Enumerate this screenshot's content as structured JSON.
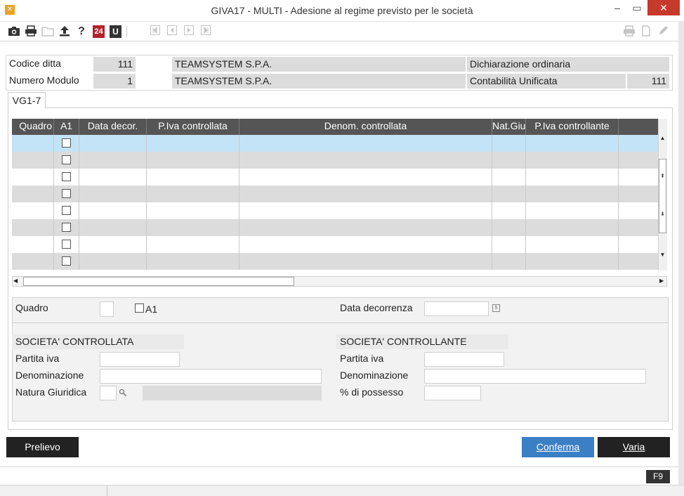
{
  "window": {
    "title": "GIVA17  - MULTI -  Adesione al regime previsto per le società",
    "minimize": "–",
    "maximize": "▭",
    "close": "✕"
  },
  "toolbar": {
    "icons": [
      "camera-icon",
      "print-icon",
      "folder-icon",
      "upload-icon",
      "help-icon",
      "calendar-24-icon",
      "u-icon",
      "first-icon",
      "prev-icon",
      "next-icon",
      "last-icon",
      "print-disabled-icon",
      "doc-disabled-icon",
      "edit-disabled-icon"
    ],
    "help": "?",
    "badge_24": "24",
    "badge_u": "U"
  },
  "header": {
    "codice_ditta_label": "Codice ditta",
    "codice_ditta_value": "111",
    "company_name_1": "TEAMSYSTEM S.P.A.",
    "dichiarazione": "Dichiarazione ordinaria",
    "numero_modulo_label": "Numero Modulo",
    "numero_modulo_value": "1",
    "company_name_2": "TEAMSYSTEM S.P.A.",
    "contabilita_label": "Contabilità Unificata",
    "contabilita_value": "111"
  },
  "tabs": [
    {
      "label": "VG1-7"
    }
  ],
  "grid": {
    "columns": [
      "Quadro",
      "A1",
      "Data decor.",
      "P.Iva controllata",
      "Denom. controllata",
      "Nat.Giu",
      "P.Iva controllante"
    ],
    "row_count": 8,
    "selected_row": 0
  },
  "detail": {
    "quadro_label": "Quadro",
    "a1_label": "A1",
    "data_decorrenza_label": "Data decorrenza",
    "controllata_title": "SOCIETA' CONTROLLATA",
    "controllante_title": "SOCIETA' CONTROLLANTE",
    "partita_iva_label": "Partita iva",
    "denominazione_label": "Denominazione",
    "natura_giuridica_label": "Natura Giuridica",
    "possesso_label": "% di possesso"
  },
  "buttons": {
    "prelievo": "Prelievo",
    "conferma": "Conferma",
    "varia": "Varia"
  },
  "status": {
    "f9": "F9"
  }
}
